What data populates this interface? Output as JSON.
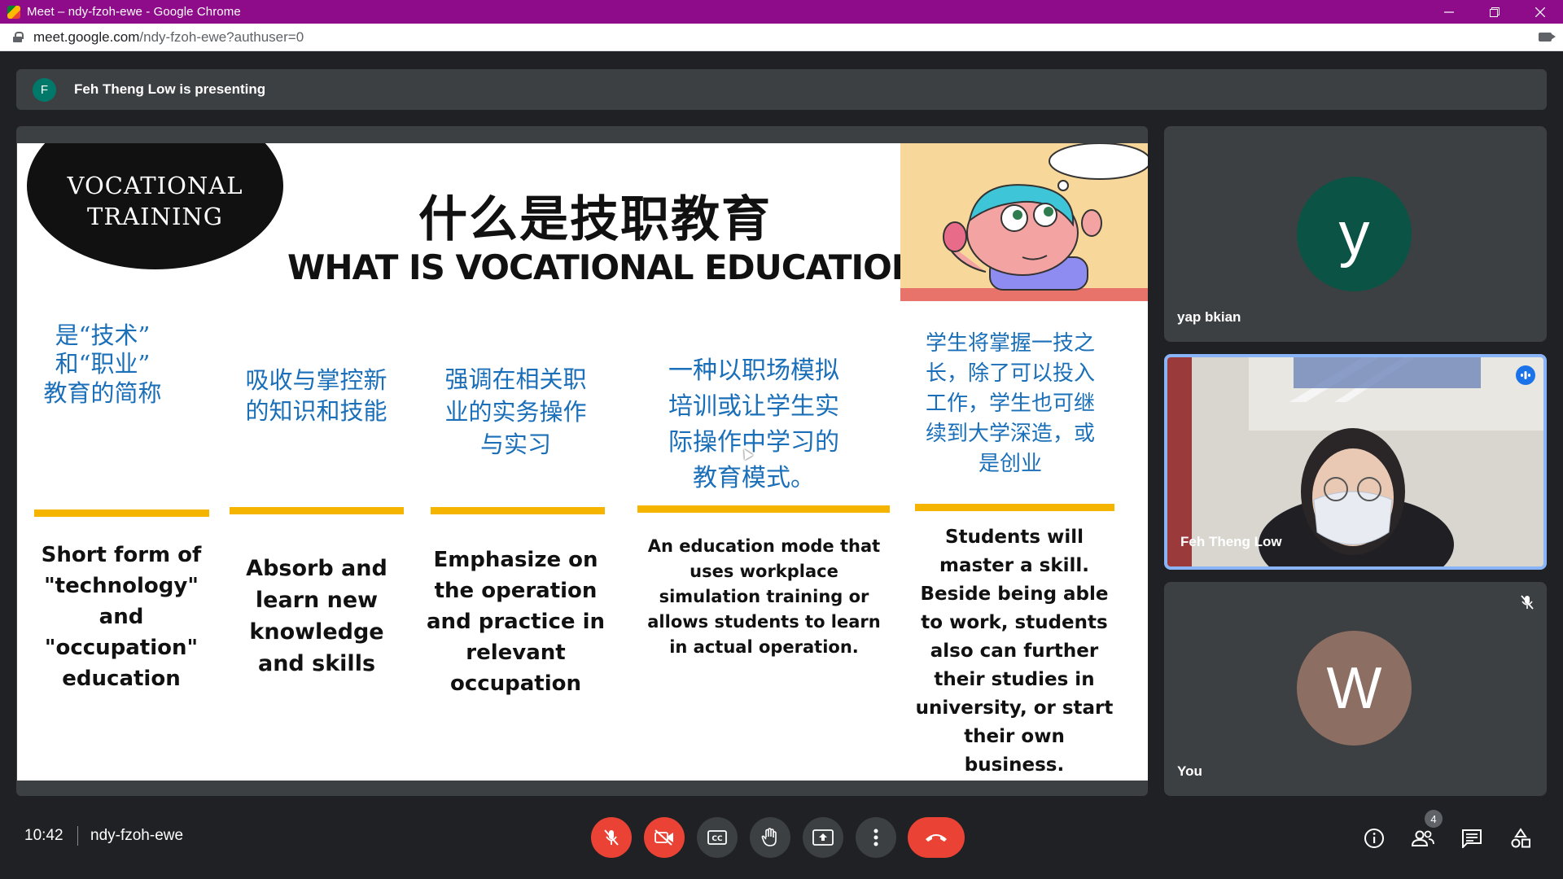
{
  "window": {
    "title": "Meet – ndy-fzoh-ewe - Google Chrome",
    "url_host": "meet.google.com",
    "url_path": "/ndy-fzoh-ewe?authuser=0",
    "controls": [
      "minimize",
      "restore",
      "close"
    ]
  },
  "banner": {
    "avatar_letter": "F",
    "text": "Feh Theng Low is presenting"
  },
  "slide": {
    "badge_line1": "VOCATIONAL",
    "badge_line2": "TRAINING",
    "title_zh": "什么是技职教育",
    "title_en": "WHAT IS VOCATIONAL EDUCATION",
    "columns": [
      {
        "zh": [
          "是“技术”",
          "和“职业”",
          "教育的简称"
        ],
        "en": [
          "Short form of",
          "\"technology\"",
          "and",
          "\"occupation\"",
          "education"
        ]
      },
      {
        "zh": [
          "吸收与掌控新",
          "的知识和技能"
        ],
        "en": [
          "Absorb and",
          "learn new",
          "knowledge",
          "and skills"
        ]
      },
      {
        "zh": [
          "强调在相关职",
          "业的实务操作",
          "与实习"
        ],
        "en": [
          "Emphasize on",
          "the operation",
          "and practice in",
          "relevant",
          "occupation"
        ]
      },
      {
        "zh": [
          "一种以职场模拟",
          "培训或让学生实",
          "际操作中学习的",
          "教育模式。"
        ],
        "en": [
          "An education mode that",
          "uses workplace",
          "simulation training or",
          "allows students to learn",
          "in actual operation."
        ]
      },
      {
        "zh": [
          "学生将掌握一技之",
          "长，除了可以投入",
          "工作，学生也可继",
          "续到大学深造，或",
          "是创业"
        ],
        "en": [
          "Students will",
          "master a skill.",
          "Beside being able",
          "to work, students",
          "also can further",
          "their studies in",
          "university, or start",
          "their own",
          "business."
        ]
      }
    ]
  },
  "participants": [
    {
      "name": "yap bkian",
      "avatar_letter": "y",
      "avatar_color": "#0b5345"
    },
    {
      "name": "Feh Theng Low",
      "video": true,
      "speaking": true
    },
    {
      "name": "You",
      "avatar_letter": "W",
      "avatar_color": "#8d6e63",
      "muted": true
    }
  ],
  "bottombar": {
    "time": "10:42",
    "meeting_code": "ndy-fzoh-ewe",
    "participant_count": "4",
    "buttons": [
      "mic-off",
      "camera-off",
      "captions",
      "raise-hand",
      "present",
      "more-options",
      "leave-call"
    ],
    "right_icons": [
      "info",
      "people",
      "chat",
      "activities"
    ]
  },
  "colors": {
    "title_bar": "#8e0c8a",
    "accent_red": "#ea4335",
    "slide_zh_text": "#1a6fb8",
    "slide_bar": "#f4b400",
    "active_tile_border": "#8ab4f8"
  }
}
